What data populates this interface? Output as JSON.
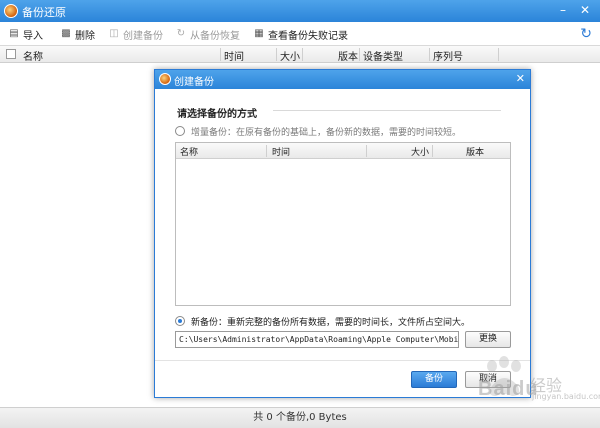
{
  "window": {
    "title": "备份还原",
    "minimize_icon": "minimize-icon",
    "close_icon": "close-icon"
  },
  "toolbar": {
    "import_label": "导入",
    "delete_label": "删除",
    "create_backup_label": "创建备份",
    "restore_label": "从备份恢复",
    "view_failed_label": "查看备份失败记录"
  },
  "list": {
    "columns": {
      "name": "名称",
      "time": "时间",
      "size": "大小",
      "version": "版本",
      "device_type": "设备类型",
      "serial": "序列号"
    }
  },
  "status": {
    "summary": "共 0 个备份,0 Bytes"
  },
  "dialog": {
    "title": "创建备份",
    "section_title": "请选择备份的方式",
    "incremental_label": "增量备份：在原有备份的基础上，备份新的数据，需要的时间较短。",
    "incremental_selected": false,
    "table_columns": {
      "name": "名称",
      "time": "时间",
      "size": "大小",
      "version": "版本"
    },
    "new_backup_label": "新备份：重新完整的备份所有数据，需要的时间长，文件所占空间大。",
    "new_backup_selected": true,
    "path_value": "C:\\Users\\Administrator\\AppData\\Roaming\\Apple Computer\\MobileSync\\",
    "change_label": "更换",
    "ok_label": "备份",
    "cancel_label": "取消"
  },
  "watermark": {
    "text": "Baidu",
    "cn": "经验",
    "url": "jingyan.baidu.com"
  }
}
